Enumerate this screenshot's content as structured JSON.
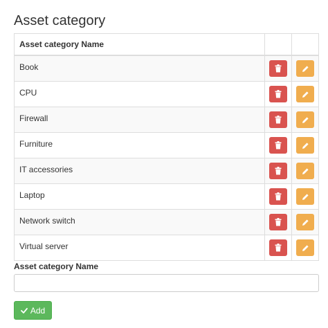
{
  "page": {
    "title": "Asset category"
  },
  "table": {
    "header": {
      "name": "Asset category Name"
    },
    "rows": [
      {
        "name": "Book"
      },
      {
        "name": "CPU"
      },
      {
        "name": "Firewall"
      },
      {
        "name": "Furniture"
      },
      {
        "name": "IT accessories"
      },
      {
        "name": "Laptop"
      },
      {
        "name": "Network switch"
      },
      {
        "name": "Virtual server"
      }
    ],
    "delete_icon": "trash-icon",
    "edit_icon": "pencil-icon"
  },
  "form": {
    "label": "Asset category Name",
    "input_value": "",
    "add_label": "Add",
    "add_icon": "check-icon"
  },
  "colors": {
    "delete": "#d9534f",
    "edit": "#f0ad4e",
    "add": "#5cb85c"
  }
}
